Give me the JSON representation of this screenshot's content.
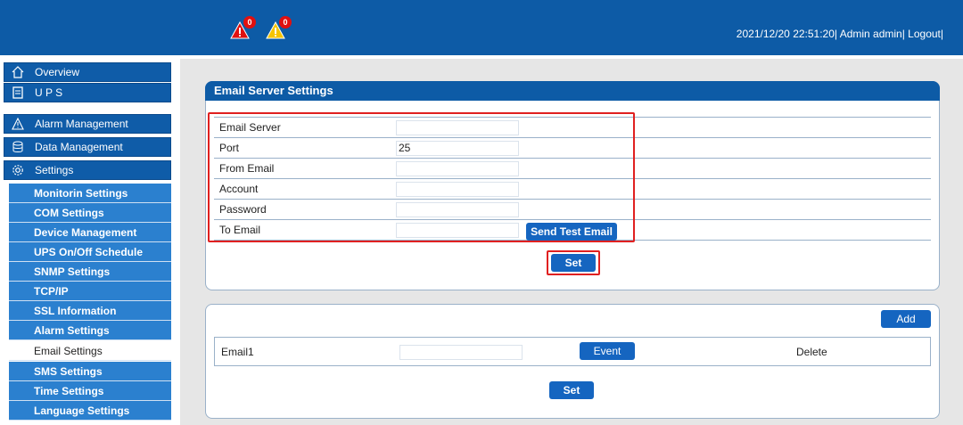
{
  "header": {
    "alarm_critical_count": "0",
    "alarm_warning_count": "0",
    "status_text": "2021/12/20 22:51:20| Admin admin| Logout|"
  },
  "sidebar": {
    "main_items": [
      {
        "label": "Overview",
        "icon": "home-icon"
      },
      {
        "label": "U P S",
        "icon": "ups-icon"
      },
      {
        "label": "Alarm Management",
        "icon": "alarm-icon"
      },
      {
        "label": "Data Management",
        "icon": "database-icon"
      },
      {
        "label": "Settings",
        "icon": "gear-icon"
      }
    ],
    "sub_items": [
      "Monitorin Settings",
      "COM Settings",
      "Device Management",
      "UPS On/Off Schedule",
      "SNMP Settings",
      "TCP/IP",
      "SSL Information",
      "Alarm Settings",
      "Email Settings",
      "SMS Settings",
      "Time Settings",
      "Language Settings"
    ],
    "active_sub": "Email Settings"
  },
  "email_server": {
    "title": "Email Server Settings",
    "fields": [
      {
        "label": "Email Server",
        "value": ""
      },
      {
        "label": "Port",
        "value": "25"
      },
      {
        "label": "From Email",
        "value": ""
      },
      {
        "label": "Account",
        "value": ""
      },
      {
        "label": "Password",
        "value": ""
      },
      {
        "label": "To Email",
        "value": ""
      }
    ],
    "test_button": "Send Test Email",
    "set_button": "Set"
  },
  "recipients": {
    "add_button": "Add",
    "rows": [
      {
        "name": "Email1",
        "value": "",
        "event_button": "Event",
        "delete_label": "Delete"
      }
    ],
    "set_button": "Set"
  },
  "colors": {
    "primary": "#0d5ba6",
    "sub_nav": "#2b80cf",
    "button": "#1565c0",
    "highlight": "#e02020",
    "alarm_critical": "#e01010",
    "alarm_warning": "#f5c400"
  }
}
